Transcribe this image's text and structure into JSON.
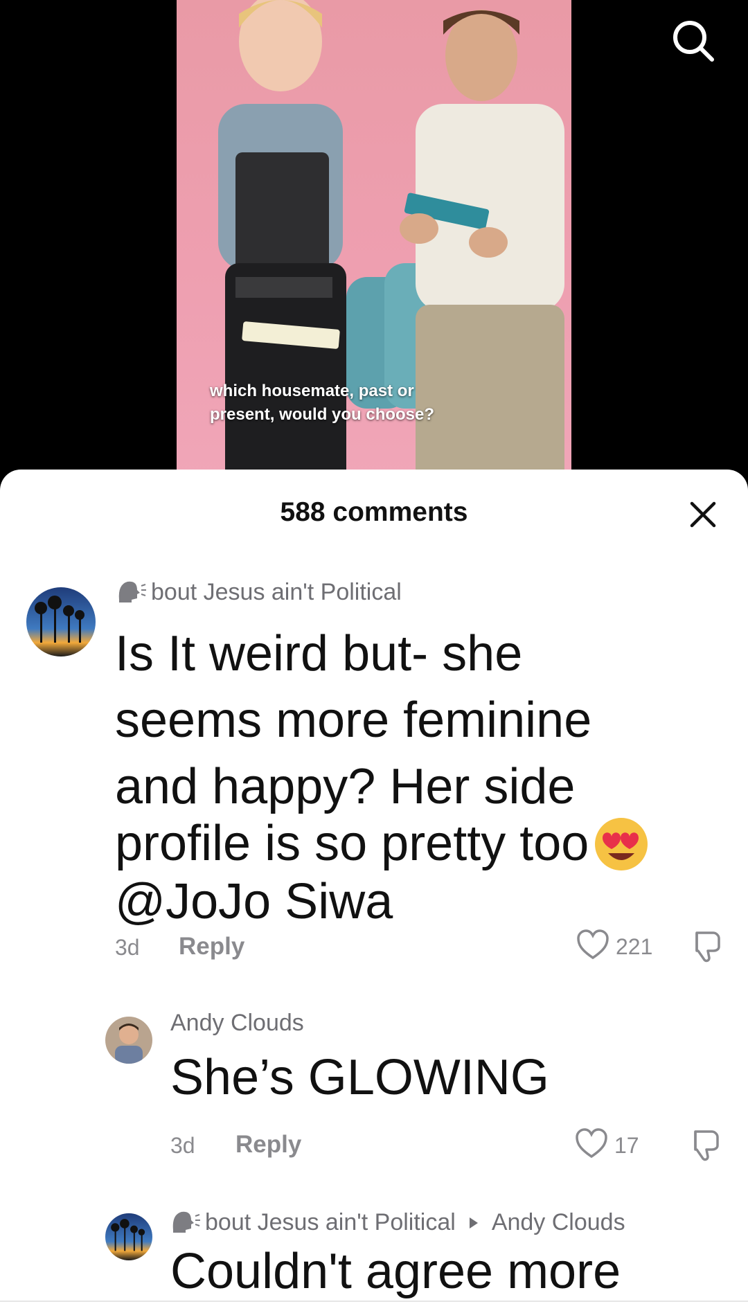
{
  "video": {
    "caption_line1": "which housemate, past or",
    "caption_line2": "present, would you choose?"
  },
  "comments_panel": {
    "count_label": "588 comments"
  },
  "comments": [
    {
      "author": "bout Jesus ain't Political",
      "lines": [
        "Is It weird but- she",
        "seems more feminine",
        "and happy? Her side",
        "profile is so pretty too",
        "@JoJo Siwa"
      ],
      "time": "3d",
      "reply_label": "Reply",
      "likes": "221"
    },
    {
      "author": "Andy Clouds",
      "text": "She’s GLOWING",
      "time": "3d",
      "reply_label": "Reply",
      "likes": "17"
    },
    {
      "author": "bout Jesus ain't Political",
      "reply_to": "Andy Clouds",
      "text": "Couldn't agree more"
    }
  ],
  "colors": {
    "secondary_text": "#8a8a8e",
    "primary_text": "#111111",
    "video_backdrop": "#ee9fb0"
  }
}
